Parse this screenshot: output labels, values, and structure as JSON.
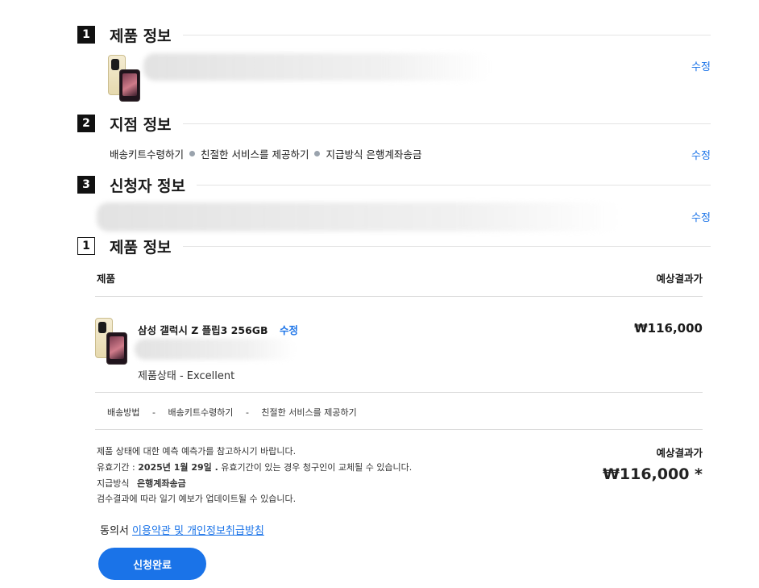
{
  "sections": {
    "product": {
      "num": "1",
      "title": "제품 정보",
      "edit": "수정"
    },
    "branch": {
      "num": "2",
      "title": "지점 정보",
      "edit": "수정",
      "items": [
        "배송키트수령하기",
        "친절한 서비스를 제공하기",
        "지급방식 은행계좌송금"
      ]
    },
    "applicant": {
      "num": "3",
      "title": "신청자 정보",
      "edit": "수정"
    },
    "summary": {
      "num": "1",
      "title": "제품 정보"
    }
  },
  "table": {
    "col_product": "제품",
    "col_estimate": "예상결과가",
    "item": {
      "name": "삼성 갤럭시 Z 플립3 256GB",
      "edit": "수정",
      "price": "₩116,000",
      "condition": "제품상태 - Excellent"
    },
    "delivery": {
      "label": "배송방법",
      "sep": "-",
      "opt1": "배송키트수령하기",
      "opt2": "친절한 서비스를 제공하기"
    }
  },
  "notes": {
    "line1": "제품 상태에 대한 예측 예측가를 참고하시기 바랍니다.",
    "validity_label": "유효기간 :",
    "validity_date": "2025년 1월 29일 .",
    "validity_tail": "유효기간이 있는 경우 청구인이 교체될 수 있습니다.",
    "payment_label": "지급방식",
    "payment_value": "은행계좌송금",
    "line4": "검수결과에 따라 일기 예보가 업데이트될 수 있습니다."
  },
  "total": {
    "label": "예상결과가",
    "value": "₩116,000 *"
  },
  "agreement": {
    "prefix": "동의서",
    "link": "이용약관 및 개인정보취급방침"
  },
  "submit": "신청완료",
  "colors": {
    "accent": "#1a73e8",
    "section_num_bg": "#111111",
    "bullet": "#9aa3ad"
  }
}
